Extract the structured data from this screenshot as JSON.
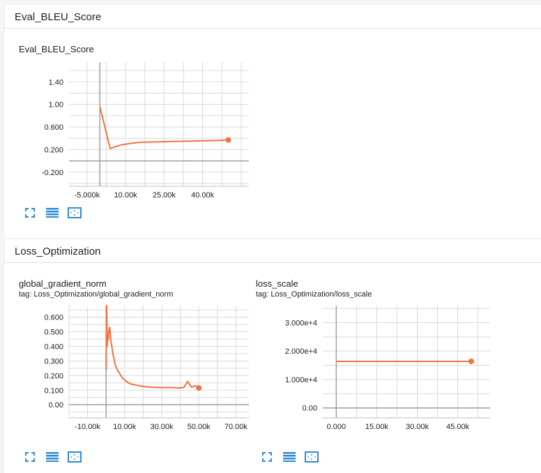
{
  "sections": [
    {
      "header": "Eval_BLEU_Score"
    },
    {
      "header": "Loss_Optimization"
    }
  ],
  "cards": {
    "bleu": {
      "title": "Eval_BLEU_Score",
      "tag": ""
    },
    "gradnorm": {
      "title": "global_gradient_norm",
      "tag": "tag: Loss_Optimization/global_gradient_norm"
    },
    "lossscale": {
      "title": "loss_scale",
      "tag": "tag: Loss_Optimization/loss_scale"
    }
  },
  "icons": {
    "expand": "fullscreen-icon",
    "log_scale": "list-lines-icon",
    "fit_domain": "fit-to-data-icon"
  },
  "colors": {
    "series": "#f4703f",
    "accent_icon": "#2a8ad6",
    "grid": "#d9d9d9",
    "axis": "#9e9e9e"
  },
  "chart_data": [
    {
      "id": "bleu",
      "type": "line",
      "title": "Eval_BLEU_Score",
      "xlim": [
        -12000,
        58000
      ],
      "ylim": [
        -0.45,
        1.75
      ],
      "x_ticks": [
        "-5.000k",
        "10.00k",
        "25.00k",
        "40.00k"
      ],
      "x_tick_values": [
        -5000,
        10000,
        25000,
        40000
      ],
      "y_ticks": [
        "-0.200",
        "0.200",
        "0.600",
        "1.00",
        "1.40"
      ],
      "y_tick_values": [
        -0.2,
        0.2,
        0.6,
        1.0,
        1.4
      ],
      "grid": true,
      "series": [
        {
          "x": [
            0,
            4000,
            8000,
            12000,
            16000,
            20000,
            25000,
            30000,
            35000,
            40000,
            45000,
            50000
          ],
          "y": [
            0.96,
            0.22,
            0.28,
            0.31,
            0.33,
            0.335,
            0.34,
            0.345,
            0.35,
            0.355,
            0.36,
            0.37
          ]
        }
      ]
    },
    {
      "id": "gradnorm",
      "type": "line",
      "title": "global_gradient_norm",
      "xlim": [
        -20000,
        77000
      ],
      "ylim": [
        -0.09,
        0.68
      ],
      "x_ticks": [
        "-10.00k",
        "10.00k",
        "30.00k",
        "50.00k",
        "70.00k"
      ],
      "x_tick_values": [
        -10000,
        10000,
        30000,
        50000,
        70000
      ],
      "y_ticks": [
        "0.00",
        "0.100",
        "0.200",
        "0.300",
        "0.400",
        "0.500",
        "0.600"
      ],
      "y_tick_values": [
        0,
        0.1,
        0.2,
        0.3,
        0.4,
        0.5,
        0.6
      ],
      "grid": true,
      "series": [
        {
          "x": [
            0,
            300,
            600,
            900,
            1200,
            1600,
            2000,
            2500,
            3000,
            3500,
            4000,
            4500,
            5000,
            6000,
            7000,
            8000,
            9000,
            10000,
            12000,
            14000,
            16000,
            18000,
            20000,
            25000,
            30000,
            35000,
            40000,
            42000,
            44000,
            46000,
            48000,
            50000
          ],
          "y": [
            0.24,
            0.68,
            0.4,
            0.48,
            0.45,
            0.52,
            0.53,
            0.44,
            0.41,
            0.36,
            0.33,
            0.3,
            0.27,
            0.24,
            0.22,
            0.2,
            0.18,
            0.17,
            0.15,
            0.14,
            0.135,
            0.13,
            0.125,
            0.12,
            0.118,
            0.118,
            0.115,
            0.12,
            0.16,
            0.12,
            0.13,
            0.115
          ]
        }
      ]
    },
    {
      "id": "lossscale",
      "type": "line",
      "title": "loss_scale",
      "xlim": [
        -5000,
        57000
      ],
      "ylim": [
        -3500,
        36000
      ],
      "x_ticks": [
        "0.000",
        "15.00k",
        "30.00k",
        "45.00k"
      ],
      "x_tick_values": [
        0,
        15000,
        30000,
        45000
      ],
      "y_ticks": [
        "0.00",
        "1.000e+4",
        "2.000e+4",
        "3.000e+4"
      ],
      "y_tick_values": [
        0,
        10000,
        20000,
        30000
      ],
      "grid": true,
      "series": [
        {
          "x": [
            0,
            50000
          ],
          "y": [
            16384,
            16384
          ]
        }
      ]
    }
  ]
}
